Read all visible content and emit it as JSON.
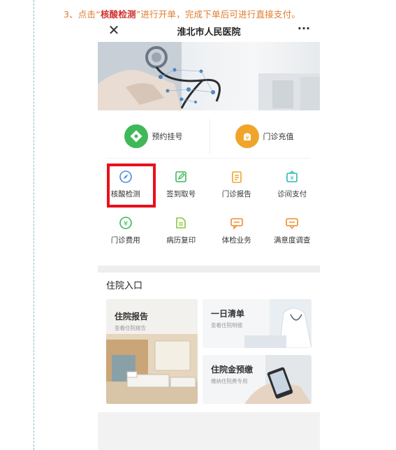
{
  "instruction": {
    "prefix": "3、点击“",
    "highlight": "核酸检测",
    "suffix": "”进行开单，完成下单后可进行直接支付。"
  },
  "app": {
    "close_icon": "close-icon",
    "title": "淮北市人民医院",
    "more_icon": "more-icon"
  },
  "quick_actions": [
    {
      "label": "预约挂号",
      "icon": "diamond-icon",
      "color": "#3fb85a"
    },
    {
      "label": "门诊充值",
      "icon": "yen-bag-icon",
      "color": "#f0a52a"
    }
  ],
  "services": [
    {
      "label": "核酸检测",
      "icon": "compass-icon",
      "color": "#4a8fe0"
    },
    {
      "label": "签到取号",
      "icon": "edit-icon",
      "color": "#3fb85a"
    },
    {
      "label": "门诊报告",
      "icon": "report-icon",
      "color": "#f0a52a"
    },
    {
      "label": "诊间支付",
      "icon": "pay-icon",
      "color": "#2fb7b0"
    },
    {
      "label": "门诊费用",
      "icon": "yen-icon",
      "color": "#3fb85a"
    },
    {
      "label": "病历复印",
      "icon": "document-icon",
      "color": "#8cc63f"
    },
    {
      "label": "体检业务",
      "icon": "chat-icon",
      "color": "#f08a2a"
    },
    {
      "label": "满意度调查",
      "icon": "survey-icon",
      "color": "#f08a2a"
    }
  ],
  "inpatient": {
    "section_title": "住院入口",
    "cards": [
      {
        "title": "住院报告",
        "subtitle": "查看住院报告"
      },
      {
        "title": "一日清单",
        "subtitle": "查看住院明细"
      },
      {
        "title": "住院金预缴",
        "subtitle": "缴纳住院费专用"
      }
    ]
  }
}
